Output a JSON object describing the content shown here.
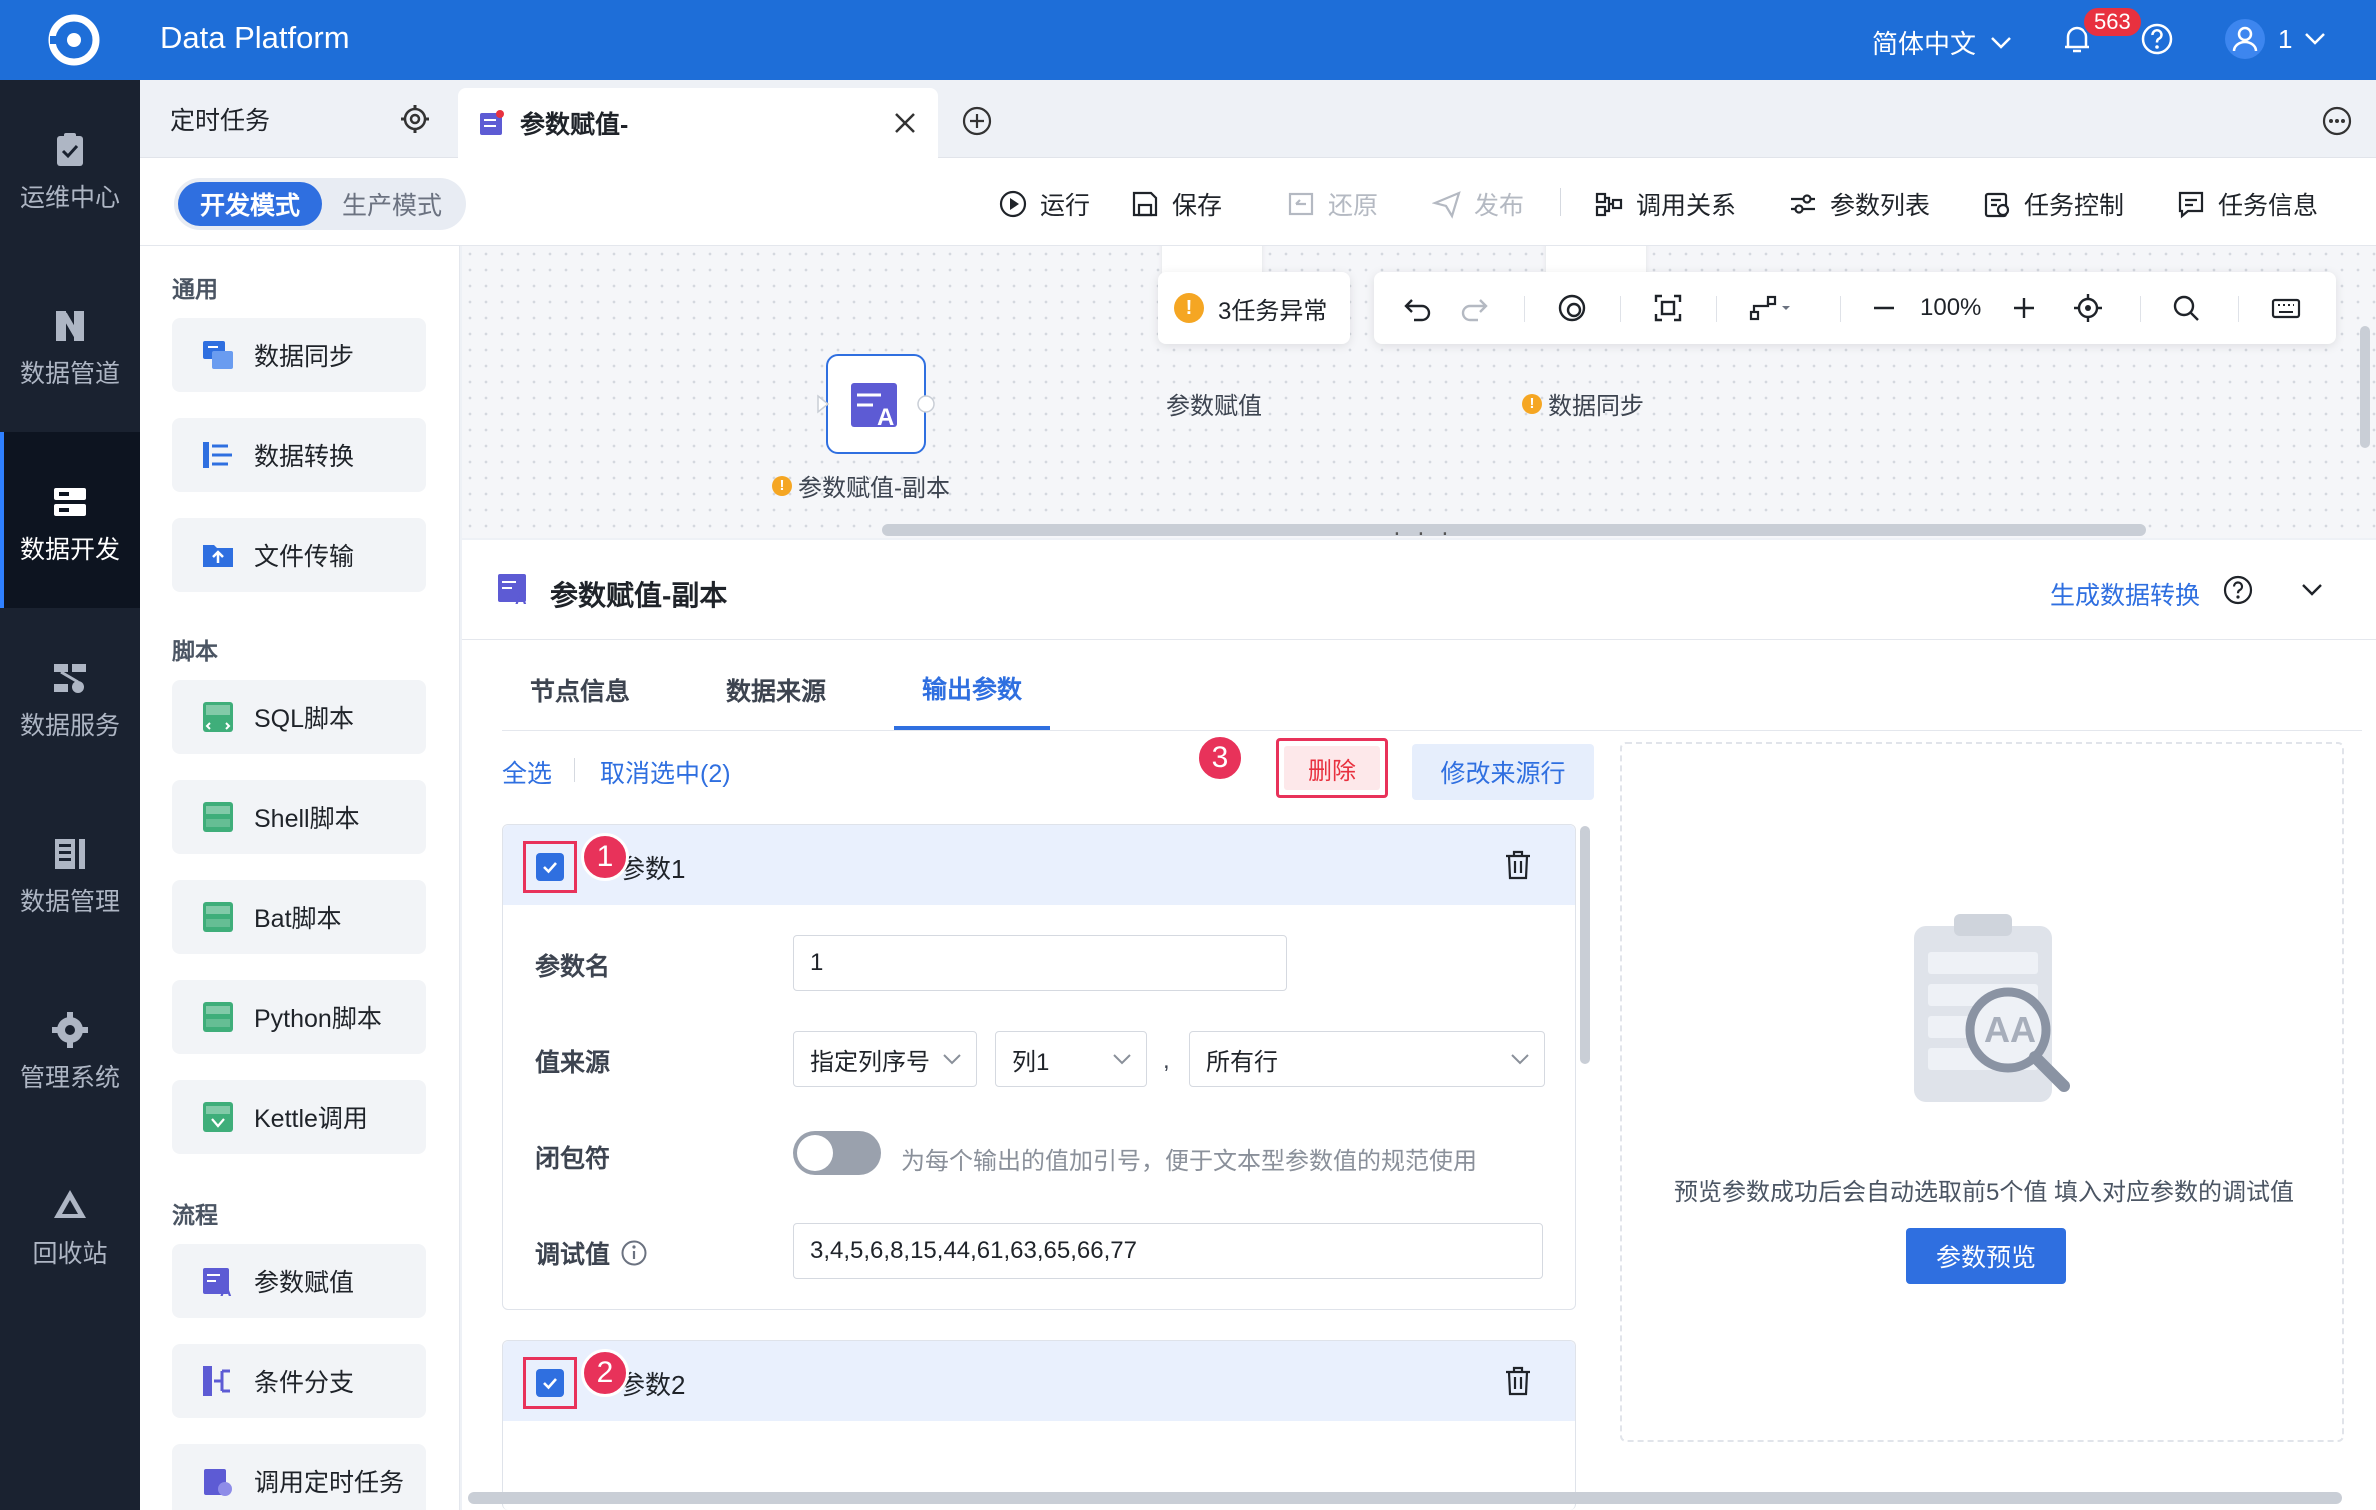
{
  "app": {
    "title": "Data Platform",
    "language": "简体中文",
    "notification_count": "563",
    "user_name": "1"
  },
  "nav": [
    {
      "label": "运维中心",
      "icon": "clipboard-check-icon"
    },
    {
      "label": "数据管道",
      "icon": "pipeline-icon"
    },
    {
      "label": "数据开发",
      "icon": "server-icon",
      "active": true
    },
    {
      "label": "数据服务",
      "icon": "service-icon"
    },
    {
      "label": "数据管理",
      "icon": "manage-icon"
    },
    {
      "label": "管理系统",
      "icon": "gear-icon"
    },
    {
      "label": "回收站",
      "icon": "recycle-icon"
    }
  ],
  "tabs": {
    "fixed": "定时任务",
    "active": "参数赋值-"
  },
  "modes": {
    "dev": "开发模式",
    "prod": "生产模式"
  },
  "toolbar": {
    "run": "运行",
    "save": "保存",
    "restore": "还原",
    "publish": "发布",
    "call_relation": "调用关系",
    "param_list": "参数列表",
    "task_control": "任务控制",
    "task_info": "任务信息"
  },
  "sidebar": {
    "sections": [
      "通用",
      "脚本",
      "流程"
    ],
    "general": [
      "数据同步",
      "数据转换",
      "文件传输"
    ],
    "scripts": [
      "SQL脚本",
      "Shell脚本",
      "Bat脚本",
      "Python脚本",
      "Kettle调用"
    ],
    "flow": [
      "参数赋值",
      "条件分支",
      "调用定时任务"
    ]
  },
  "canvas": {
    "alert": "3任务异常",
    "zoom": "100%",
    "nodes": [
      "参数赋值-副本",
      "参数赋值",
      "数据同步"
    ]
  },
  "panel": {
    "title": "参数赋值-副本",
    "generate_link": "生成数据转换",
    "tabs": [
      "节点信息",
      "数据来源",
      "输出参数"
    ],
    "active_tab": "输出参数",
    "select_all": "全选",
    "unselect": "取消选中(2)",
    "delete": "删除",
    "modify_source": "修改来源行",
    "steps": [
      "1",
      "2",
      "3"
    ],
    "params": [
      {
        "name": "参数1",
        "label_name": "参数名",
        "value_name": "1",
        "label_source": "值来源",
        "source_mode": "指定列序号",
        "source_col": "列1",
        "comma": ",",
        "source_rows": "所有行",
        "label_wrap": "闭包符",
        "wrap_hint": "为每个输出的值加引号，便于文本型参数值的规范使用",
        "label_debug": "调试值",
        "debug_value": "3,4,5,6,8,15,44,61,63,65,66,77"
      },
      {
        "name": "参数2"
      }
    ],
    "preview_hint": "预览参数成功后会自动选取前5个值 填入对应参数的调试值",
    "preview_button": "参数预览"
  }
}
